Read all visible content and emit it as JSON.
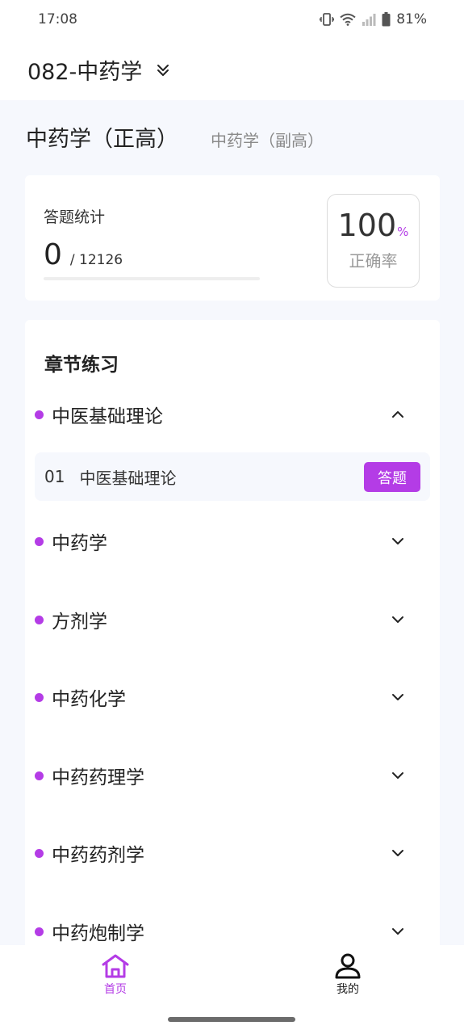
{
  "status_bar": {
    "time": "17:08",
    "battery": "81%",
    "icons": [
      "vibrate-icon",
      "wifi-icon",
      "signal-icon",
      "battery-icon"
    ]
  },
  "header": {
    "exam_title": "082-中药学",
    "dropdown_icon": "chevron-double-down-icon"
  },
  "level_tabs": {
    "active": "中药学（正高）",
    "inactive": "中药学（副高）"
  },
  "stats": {
    "label": "答题统计",
    "answered": "0",
    "total": "/ 12126",
    "progress_fraction": 0,
    "accuracy_value": "100",
    "accuracy_unit": "%",
    "accuracy_label": "正确率"
  },
  "chapters": {
    "title": "章节练习",
    "items": [
      {
        "name": "中医基础理论",
        "expanded": true
      },
      {
        "name": "中药学",
        "expanded": false
      },
      {
        "name": "方剂学",
        "expanded": false
      },
      {
        "name": "中药化学",
        "expanded": false
      },
      {
        "name": "中药药理学",
        "expanded": false
      },
      {
        "name": "中药药剂学",
        "expanded": false
      },
      {
        "name": "中药炮制学",
        "expanded": false
      }
    ],
    "sub_items": [
      {
        "index": "01",
        "name": "中医基础理论",
        "button": "答题"
      }
    ]
  },
  "bottom_nav": {
    "items": [
      {
        "label": "首页",
        "icon": "home-icon",
        "active": true
      },
      {
        "label": "我的",
        "icon": "user-icon",
        "active": false
      }
    ]
  },
  "colors": {
    "accent": "#b43ce6",
    "page_background": "#f6f8fd",
    "card_background": "#ffffff"
  }
}
